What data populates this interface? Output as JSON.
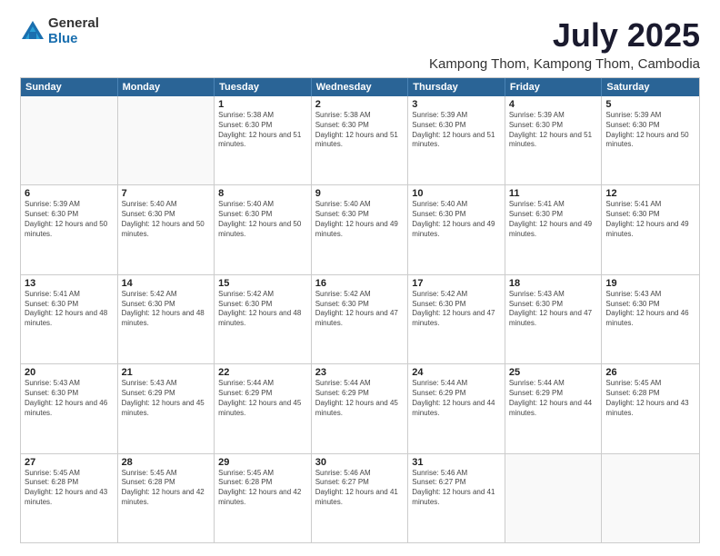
{
  "logo": {
    "general": "General",
    "blue": "Blue"
  },
  "title": "July 2025",
  "subtitle": "Kampong Thom, Kampong Thom, Cambodia",
  "header_days": [
    "Sunday",
    "Monday",
    "Tuesday",
    "Wednesday",
    "Thursday",
    "Friday",
    "Saturday"
  ],
  "weeks": [
    [
      {
        "day": "",
        "info": ""
      },
      {
        "day": "",
        "info": ""
      },
      {
        "day": "1",
        "info": "Sunrise: 5:38 AM\nSunset: 6:30 PM\nDaylight: 12 hours and 51 minutes."
      },
      {
        "day": "2",
        "info": "Sunrise: 5:38 AM\nSunset: 6:30 PM\nDaylight: 12 hours and 51 minutes."
      },
      {
        "day": "3",
        "info": "Sunrise: 5:39 AM\nSunset: 6:30 PM\nDaylight: 12 hours and 51 minutes."
      },
      {
        "day": "4",
        "info": "Sunrise: 5:39 AM\nSunset: 6:30 PM\nDaylight: 12 hours and 51 minutes."
      },
      {
        "day": "5",
        "info": "Sunrise: 5:39 AM\nSunset: 6:30 PM\nDaylight: 12 hours and 50 minutes."
      }
    ],
    [
      {
        "day": "6",
        "info": "Sunrise: 5:39 AM\nSunset: 6:30 PM\nDaylight: 12 hours and 50 minutes."
      },
      {
        "day": "7",
        "info": "Sunrise: 5:40 AM\nSunset: 6:30 PM\nDaylight: 12 hours and 50 minutes."
      },
      {
        "day": "8",
        "info": "Sunrise: 5:40 AM\nSunset: 6:30 PM\nDaylight: 12 hours and 50 minutes."
      },
      {
        "day": "9",
        "info": "Sunrise: 5:40 AM\nSunset: 6:30 PM\nDaylight: 12 hours and 49 minutes."
      },
      {
        "day": "10",
        "info": "Sunrise: 5:40 AM\nSunset: 6:30 PM\nDaylight: 12 hours and 49 minutes."
      },
      {
        "day": "11",
        "info": "Sunrise: 5:41 AM\nSunset: 6:30 PM\nDaylight: 12 hours and 49 minutes."
      },
      {
        "day": "12",
        "info": "Sunrise: 5:41 AM\nSunset: 6:30 PM\nDaylight: 12 hours and 49 minutes."
      }
    ],
    [
      {
        "day": "13",
        "info": "Sunrise: 5:41 AM\nSunset: 6:30 PM\nDaylight: 12 hours and 48 minutes."
      },
      {
        "day": "14",
        "info": "Sunrise: 5:42 AM\nSunset: 6:30 PM\nDaylight: 12 hours and 48 minutes."
      },
      {
        "day": "15",
        "info": "Sunrise: 5:42 AM\nSunset: 6:30 PM\nDaylight: 12 hours and 48 minutes."
      },
      {
        "day": "16",
        "info": "Sunrise: 5:42 AM\nSunset: 6:30 PM\nDaylight: 12 hours and 47 minutes."
      },
      {
        "day": "17",
        "info": "Sunrise: 5:42 AM\nSunset: 6:30 PM\nDaylight: 12 hours and 47 minutes."
      },
      {
        "day": "18",
        "info": "Sunrise: 5:43 AM\nSunset: 6:30 PM\nDaylight: 12 hours and 47 minutes."
      },
      {
        "day": "19",
        "info": "Sunrise: 5:43 AM\nSunset: 6:30 PM\nDaylight: 12 hours and 46 minutes."
      }
    ],
    [
      {
        "day": "20",
        "info": "Sunrise: 5:43 AM\nSunset: 6:30 PM\nDaylight: 12 hours and 46 minutes."
      },
      {
        "day": "21",
        "info": "Sunrise: 5:43 AM\nSunset: 6:29 PM\nDaylight: 12 hours and 45 minutes."
      },
      {
        "day": "22",
        "info": "Sunrise: 5:44 AM\nSunset: 6:29 PM\nDaylight: 12 hours and 45 minutes."
      },
      {
        "day": "23",
        "info": "Sunrise: 5:44 AM\nSunset: 6:29 PM\nDaylight: 12 hours and 45 minutes."
      },
      {
        "day": "24",
        "info": "Sunrise: 5:44 AM\nSunset: 6:29 PM\nDaylight: 12 hours and 44 minutes."
      },
      {
        "day": "25",
        "info": "Sunrise: 5:44 AM\nSunset: 6:29 PM\nDaylight: 12 hours and 44 minutes."
      },
      {
        "day": "26",
        "info": "Sunrise: 5:45 AM\nSunset: 6:28 PM\nDaylight: 12 hours and 43 minutes."
      }
    ],
    [
      {
        "day": "27",
        "info": "Sunrise: 5:45 AM\nSunset: 6:28 PM\nDaylight: 12 hours and 43 minutes."
      },
      {
        "day": "28",
        "info": "Sunrise: 5:45 AM\nSunset: 6:28 PM\nDaylight: 12 hours and 42 minutes."
      },
      {
        "day": "29",
        "info": "Sunrise: 5:45 AM\nSunset: 6:28 PM\nDaylight: 12 hours and 42 minutes."
      },
      {
        "day": "30",
        "info": "Sunrise: 5:46 AM\nSunset: 6:27 PM\nDaylight: 12 hours and 41 minutes."
      },
      {
        "day": "31",
        "info": "Sunrise: 5:46 AM\nSunset: 6:27 PM\nDaylight: 12 hours and 41 minutes."
      },
      {
        "day": "",
        "info": ""
      },
      {
        "day": "",
        "info": ""
      }
    ]
  ]
}
